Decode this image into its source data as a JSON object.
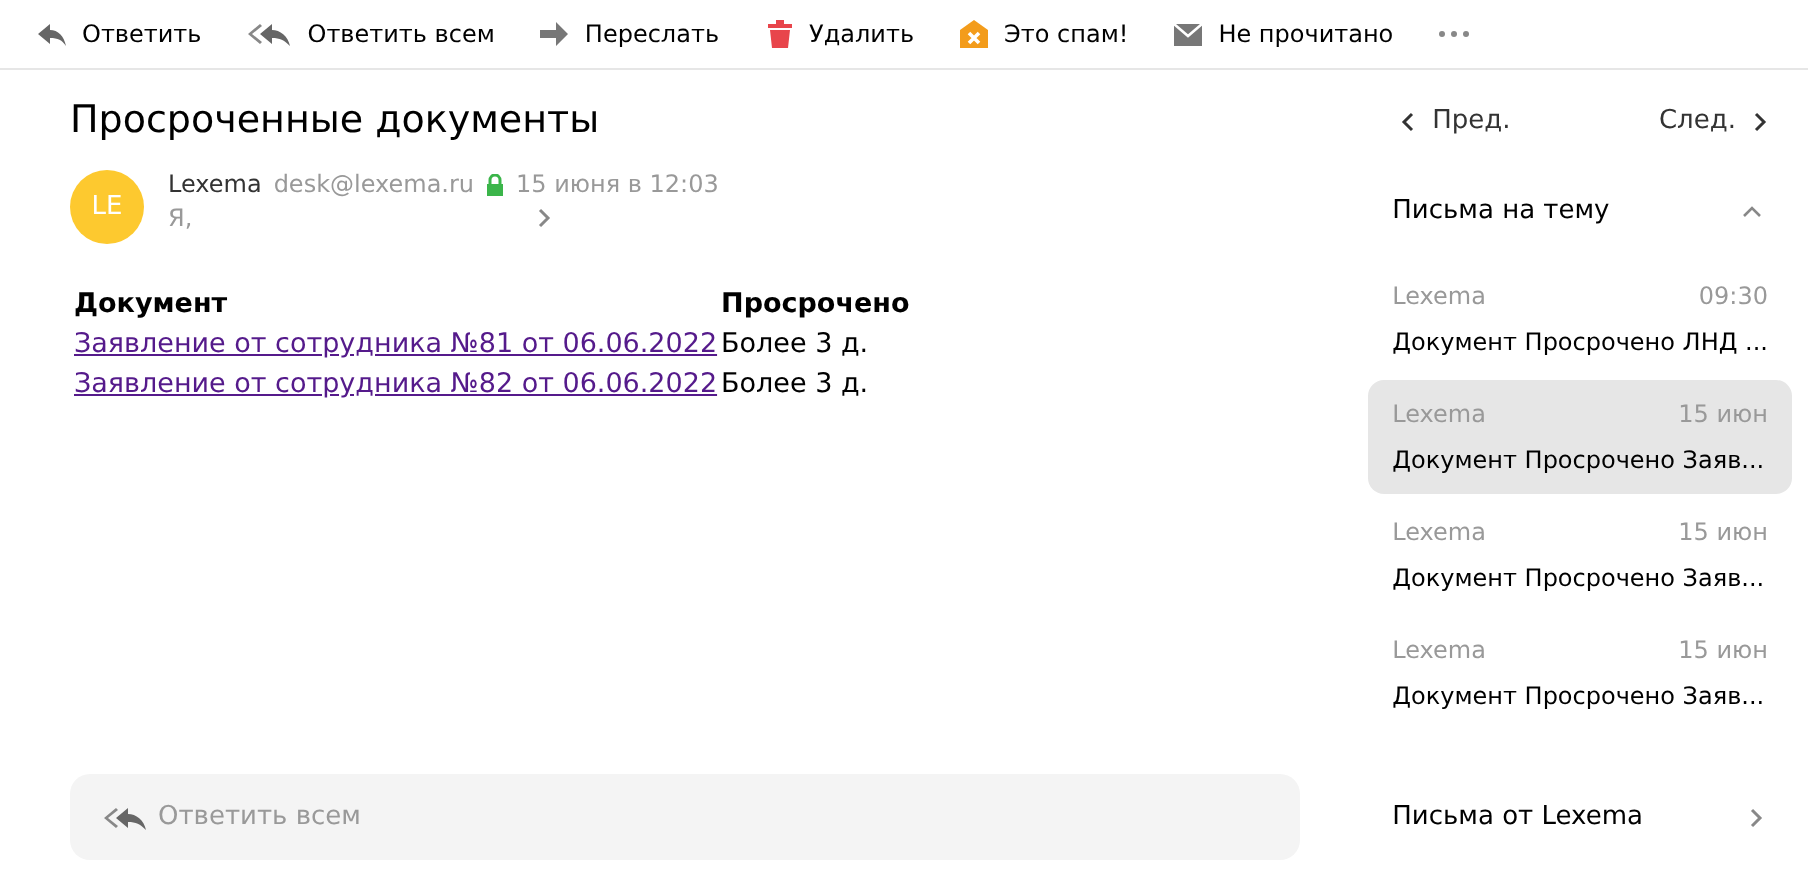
{
  "toolbar": [
    {
      "kind": "reply",
      "label": "Ответить"
    },
    {
      "kind": "reply-all",
      "label": "Ответить всем"
    },
    {
      "kind": "forward",
      "label": "Переслать"
    },
    {
      "kind": "delete",
      "label": "Удалить"
    },
    {
      "kind": "spam",
      "label": "Это спам!"
    },
    {
      "kind": "unread",
      "label": "Не прочитано"
    },
    {
      "kind": "more"
    }
  ],
  "message": {
    "subject": "Просроченные документы",
    "avatar": "LE",
    "sender": "Lexema",
    "email": "desk@lexema.ru",
    "date": "15 июня в 12:03",
    "to": "Я,",
    "table": {
      "columns": [
        "Документ",
        "Просрочено"
      ],
      "rows": [
        [
          "Заявление от сотрудника №81 от 06.06.2022",
          "Более 3 д."
        ],
        [
          "Заявление от сотрудника №82 от 06.06.2022",
          "Более 3 д."
        ]
      ]
    }
  },
  "reply_box": {
    "placeholder": "Ответить всем"
  },
  "sidebar": {
    "prev": "Пред.",
    "next": "След.",
    "thread_title": "Письма на тему",
    "expanded": true,
    "thread": [
      {
        "from": "Lexema",
        "time": "09:30",
        "subject": "Документ Просрочено ЛНД ...",
        "selected": false
      },
      {
        "from": "Lexema",
        "time": "15 июн",
        "subject": "Документ Просрочено Заяв...",
        "selected": true
      },
      {
        "from": "Lexema",
        "time": "15 июн",
        "subject": "Документ Просрочено Заяв...",
        "selected": false
      },
      {
        "from": "Lexema",
        "time": "15 июн",
        "subject": "Документ Просрочено Заяв...",
        "selected": false
      }
    ],
    "from_link": "Письма от Lexema"
  }
}
